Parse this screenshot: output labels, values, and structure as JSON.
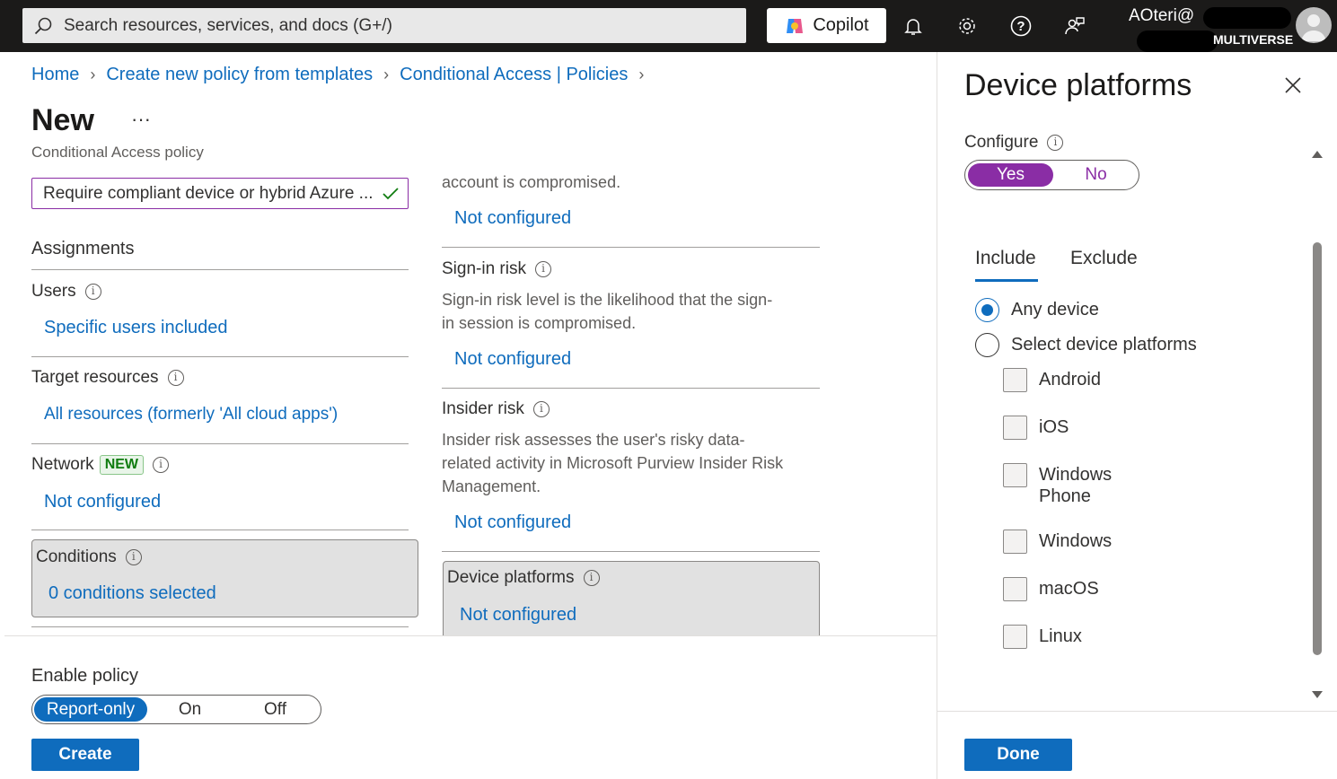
{
  "topbar": {
    "search_placeholder": "Search resources, services, and docs (G+/)",
    "copilot_label": "Copilot",
    "user_name": "AOteri@",
    "tenant": "MULTIVERSE"
  },
  "breadcrumb": [
    "Home",
    "Create new policy from templates",
    "Conditional Access | Policies"
  ],
  "page": {
    "title": "New",
    "more": "···",
    "subtitle": "Conditional Access policy",
    "policy_name": "Require compliant device or hybrid Azure ..."
  },
  "assignments": {
    "heading": "Assignments",
    "users": {
      "label": "Users",
      "value": "Specific users included"
    },
    "target_resources": {
      "label": "Target resources",
      "value": "All resources (formerly 'All cloud apps')"
    },
    "network": {
      "label": "Network",
      "badge": "NEW",
      "value": "Not configured"
    },
    "conditions": {
      "label": "Conditions",
      "value": "0 conditions selected"
    }
  },
  "conditions_column": {
    "user_risk": {
      "desc_tail": "account is compromised.",
      "value": "Not configured"
    },
    "sign_in_risk": {
      "label": "Sign-in risk",
      "desc": "Sign-in risk level is the likelihood that the sign-in session is compromised.",
      "desc_line1": "Sign-in risk level is the likelihood that the sign-",
      "desc_line2": "in session is compromised.",
      "value": "Not configured"
    },
    "insider_risk": {
      "label": "Insider risk",
      "desc_line1": "Insider risk assesses the user's risky data-",
      "desc_line2": "related activity in Microsoft Purview Insider Risk",
      "desc_line3": "Management.",
      "value": "Not configured"
    },
    "device_platforms": {
      "label": "Device platforms",
      "value": "Not configured"
    }
  },
  "enable_policy": {
    "label": "Enable policy",
    "options": [
      "Report-only",
      "On",
      "Off"
    ],
    "selected": "Report-only"
  },
  "create_button": "Create",
  "panel": {
    "title": "Device platforms",
    "configure_label": "Configure",
    "configure_options": [
      "Yes",
      "No"
    ],
    "configure_selected": "Yes",
    "tabs": [
      "Include",
      "Exclude"
    ],
    "active_tab": "Include",
    "radios": [
      {
        "label": "Any device",
        "selected": true
      },
      {
        "label": "Select device platforms",
        "selected": false
      }
    ],
    "platforms": [
      "Android",
      "iOS",
      "Windows Phone",
      "Windows",
      "macOS",
      "Linux"
    ],
    "done_button": "Done"
  },
  "colors": {
    "accent": "#0f6cbd",
    "purple": "#8a2da5",
    "topbar": "#1b1a19"
  }
}
